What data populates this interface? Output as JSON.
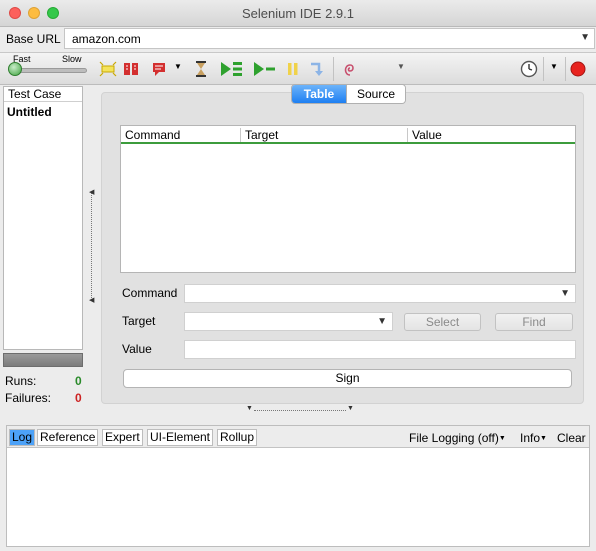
{
  "window": {
    "title": "Selenium IDE 2.9.1"
  },
  "base_url": {
    "label": "Base URL",
    "value": "amazon.com"
  },
  "toolbar": {
    "speed_fast": "Fast",
    "speed_slow": "Slow",
    "icons": [
      "speed-slider",
      "highlight-elements-icon",
      "breakpoint-icon",
      "record-menu-icon",
      "pause-timer-icon",
      "play-all-icon",
      "play-current-icon",
      "pause-icon",
      "step-icon",
      "rollup-icon",
      "schedule-icon",
      "record-button"
    ],
    "colors": {
      "play": "#2ea12e",
      "record": "#e8231f",
      "pause": "#f0d24a"
    }
  },
  "test_case": {
    "header": "Test Case",
    "items": [
      "Untitled"
    ]
  },
  "stats": {
    "runs_label": "Runs:",
    "runs": "0",
    "failures_label": "Failures:",
    "failures": "0",
    "runs_color": "#2a8a2a",
    "failures_color": "#cc2222"
  },
  "editor": {
    "tabs": [
      "Table",
      "Source"
    ],
    "active_tab": "Table",
    "columns": [
      "Command",
      "Target",
      "Value"
    ],
    "command_label": "Command",
    "target_label": "Target",
    "value_label": "Value",
    "command_value": "",
    "target_value": "",
    "value_value": "",
    "select_button": "Select",
    "find_button": "Find",
    "sign_button": "Sign"
  },
  "log": {
    "tabs": [
      "Log",
      "Reference",
      "Expert",
      "UI-Element",
      "Rollup"
    ],
    "active_tab": "Log",
    "file_logging": "File Logging (off)",
    "info": "Info",
    "clear": "Clear"
  }
}
